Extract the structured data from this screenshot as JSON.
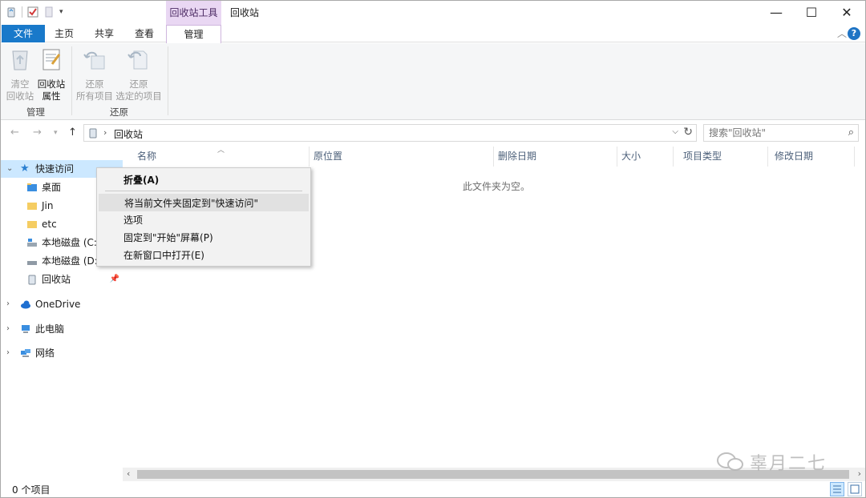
{
  "window": {
    "contextual_group": "回收站工具",
    "title": "回收站",
    "controls": {
      "minimize": "—",
      "maximize": "☐",
      "close": "✕"
    }
  },
  "ribbon_tabs": {
    "file": "文件",
    "home": "主页",
    "share": "共享",
    "view": "查看",
    "manage": "管理"
  },
  "ribbon": {
    "empty_recycle_bin": {
      "line1": "清空",
      "line2": "回收站"
    },
    "recycle_bin_properties": {
      "line1": "回收站",
      "line2": "属性"
    },
    "restore_all": {
      "line1": "还原",
      "line2": "所有项目"
    },
    "restore_selected": {
      "line1": "还原",
      "line2": "选定的项目"
    },
    "group_manage": "管理",
    "group_restore": "还原"
  },
  "address": {
    "crumb": "回收站",
    "search_placeholder": "搜索\"回收站\""
  },
  "nav": {
    "quick_access": "快速访问",
    "items": [
      {
        "label": "桌面"
      },
      {
        "label": "Jin"
      },
      {
        "label": "etc"
      },
      {
        "label": "本地磁盘 (C:)"
      },
      {
        "label": "本地磁盘 (D:)"
      },
      {
        "label": "回收站"
      }
    ],
    "onedrive": "OneDrive",
    "this_pc": "此电脑",
    "network": "网络"
  },
  "columns": [
    "名称",
    "原位置",
    "删除日期",
    "大小",
    "项目类型",
    "修改日期"
  ],
  "empty_message": "此文件夹为空。",
  "context_menu": {
    "collapse": "折叠(A)",
    "pin_quick_access": "将当前文件夹固定到\"快速访问\"",
    "options": "选项",
    "pin_start": "固定到\"开始\"屏幕(P)",
    "open_new_window": "在新窗口中打开(E)"
  },
  "status": {
    "item_count": "0 个项目"
  },
  "watermark": "辜月二七",
  "colors": {
    "accent": "#1979ca",
    "contextual_tab": "#e9d7f3",
    "selection": "#cce8ff",
    "ribbon_bg": "#f5f6f7"
  }
}
